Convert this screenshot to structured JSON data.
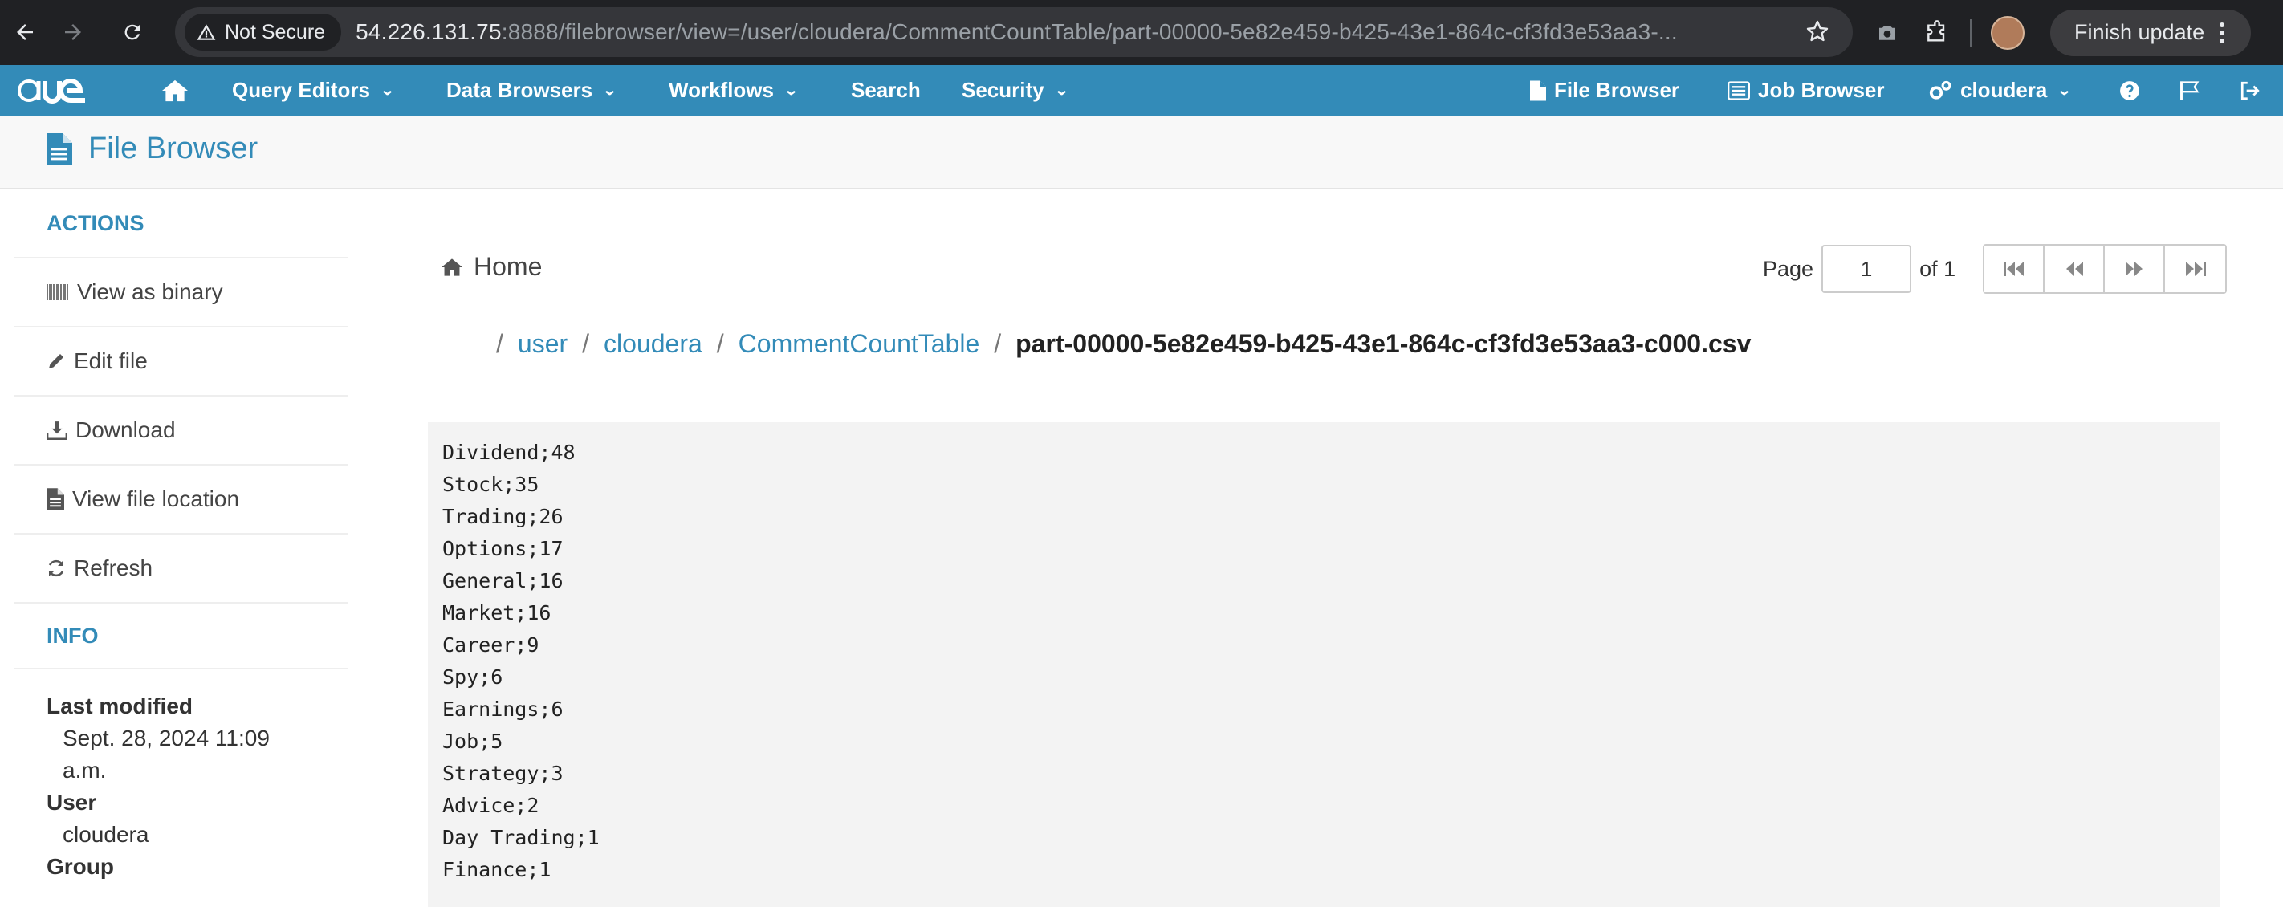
{
  "browser": {
    "security_label": "Not Secure",
    "url_host": "54.226.131.75",
    "url_rest": ":8888/filebrowser/view=/user/cloudera/CommentCountTable/part-00000-5e82e459-b425-43e1-864c-cf3fd3e53aa3-...",
    "finish_update_label": "Finish update"
  },
  "navbar": {
    "logo": "HUE",
    "menus": [
      "Query Editors",
      "Data Browsers",
      "Workflows",
      "Search",
      "Security"
    ],
    "right": {
      "file_browser": "File Browser",
      "job_browser": "Job Browser",
      "user": "cloudera"
    },
    "colors": {
      "bar": "#338bb8"
    }
  },
  "page": {
    "title": "File Browser"
  },
  "sidebar": {
    "actions_heading": "ACTIONS",
    "actions": [
      {
        "label": "View as binary",
        "icon": "barcode-icon"
      },
      {
        "label": "Edit file",
        "icon": "pencil-icon"
      },
      {
        "label": "Download",
        "icon": "download-icon"
      },
      {
        "label": "View file location",
        "icon": "file-icon"
      },
      {
        "label": "Refresh",
        "icon": "refresh-icon"
      }
    ],
    "info_heading": "INFO",
    "info": {
      "last_modified_label": "Last modified",
      "last_modified_value": "Sept. 28, 2024 11:09 a.m.",
      "user_label": "User",
      "user_value": "cloudera",
      "group_label": "Group"
    }
  },
  "main": {
    "home_label": "Home",
    "pager": {
      "page_label": "Page",
      "page_value": "1",
      "of_label": "of 1"
    },
    "breadcrumb": [
      "user",
      "cloudera",
      "CommentCountTable"
    ],
    "filename": "part-00000-5e82e459-b425-43e1-864c-cf3fd3e53aa3-c000.csv",
    "file_lines": [
      "Dividend;48",
      "Stock;35",
      "Trading;26",
      "Options;17",
      "General;16",
      "Market;16",
      "Career;9",
      "Spy;6",
      "Earnings;6",
      "Job;5",
      "Strategy;3",
      "Advice;2",
      "Day Trading;1",
      "Finance;1"
    ]
  }
}
